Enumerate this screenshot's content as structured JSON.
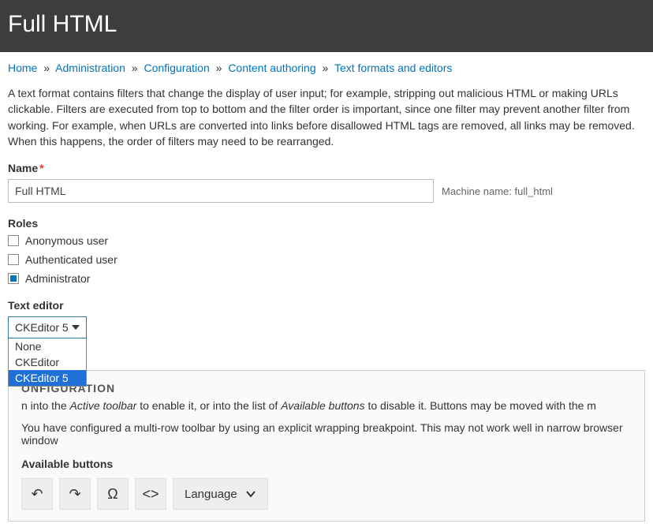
{
  "header": {
    "title": "Full HTML"
  },
  "breadcrumb": {
    "items": [
      "Home",
      "Administration",
      "Configuration",
      "Content authoring",
      "Text formats and editors"
    ],
    "separator": "»"
  },
  "description": "A text format contains filters that change the display of user input; for example, stripping out malicious HTML or making URLs clickable. Filters are executed from top to bottom and the filter order is important, since one filter may prevent another filter from working. For example, when URLs are converted into links before disallowed HTML tags are removed, all links may be removed. When this happens, the order of filters may need to be rearranged.",
  "name_field": {
    "label": "Name",
    "value": "Full HTML",
    "machine_label": "Machine name:",
    "machine_value": "full_html"
  },
  "roles": {
    "label": "Roles",
    "items": [
      {
        "label": "Anonymous user",
        "checked": false
      },
      {
        "label": "Authenticated user",
        "checked": false
      },
      {
        "label": "Administrator",
        "checked": true
      }
    ]
  },
  "text_editor": {
    "label": "Text editor",
    "selected": "CKEditor 5",
    "options": [
      "None",
      "CKEditor",
      "CKEditor 5"
    ]
  },
  "toolbar_config": {
    "title": "ONFIGURATION",
    "hint_prefix": "n into the ",
    "hint_active": "Active toolbar",
    "hint_mid": " to enable it, or into the list of ",
    "hint_avail": "Available buttons",
    "hint_suffix": " to disable it. Buttons may be moved with the m",
    "note": "You have configured a multi-row toolbar by using an explicit wrapping breakpoint. This may not work well in narrow browser window",
    "available_label": "Available buttons",
    "buttons": {
      "undo": "↶",
      "redo": "↷",
      "omega": "Ω",
      "code": "<>",
      "language": "Language"
    }
  }
}
